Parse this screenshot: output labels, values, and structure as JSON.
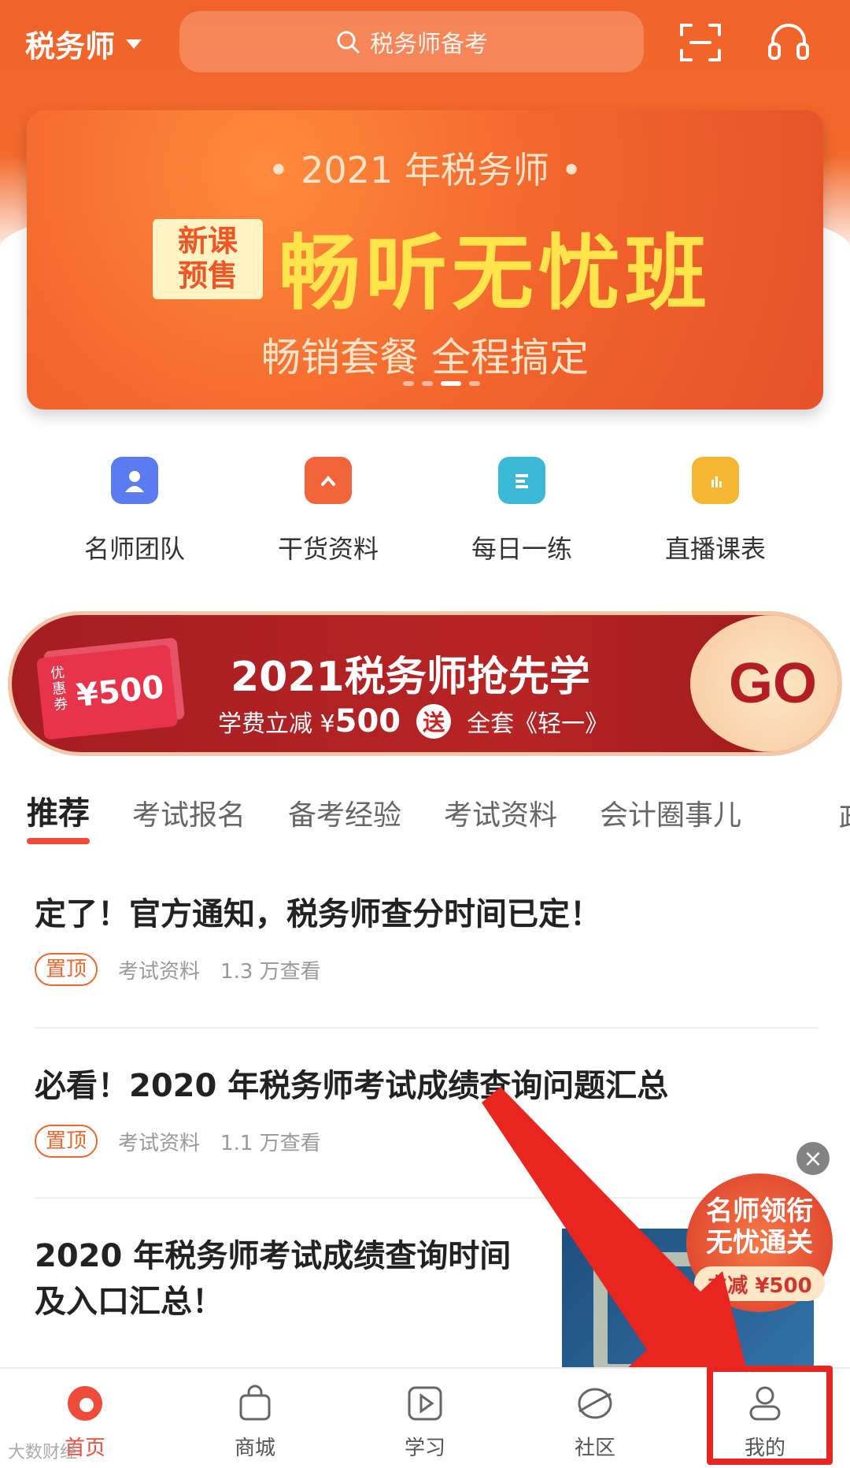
{
  "header": {
    "city": "税务师",
    "search_placeholder": "税务师备考"
  },
  "banner": {
    "subtitle": "• 2021 年税务师 •",
    "badge_line1": "新课",
    "badge_line2": "预售",
    "main": "畅听无忧班",
    "tagline": "畅销套餐 全程搞定"
  },
  "quick_entries": [
    {
      "label": "名师团队",
      "icon": "teacher-icon",
      "color": "#5b7cf0"
    },
    {
      "label": "干货资料",
      "icon": "folder-icon",
      "color": "#f2653a"
    },
    {
      "label": "每日一练",
      "icon": "calendar-icon",
      "color": "#3bb8d6"
    },
    {
      "label": "直播课表",
      "icon": "tv-icon",
      "color": "#f5b731"
    }
  ],
  "promo": {
    "coupon_tag": "优惠券",
    "coupon_value": "¥500",
    "title": "2021税务师抢先学",
    "sub_prefix": "学费立减 ¥",
    "sub_amount": "500",
    "send": "送",
    "sub_suffix": "全套《轻一》",
    "go": "GO"
  },
  "tabs": [
    "推荐",
    "考试报名",
    "备考经验",
    "考试资料",
    "会计圈事儿",
    "政"
  ],
  "articles": [
    {
      "title": "定了！官方通知，税务师查分时间已定！",
      "tag": "置顶",
      "category": "考试资料",
      "views": "1.3 万查看"
    },
    {
      "title": "必看！2020 年税务师考试成绩查询问题汇总",
      "tag": "置顶",
      "category": "考试资料",
      "views": "1.1 万查看"
    },
    {
      "title_line1": "2020 年税务师考试成绩查询时间",
      "title_line2": "及入口汇总！"
    }
  ],
  "float_ad": {
    "line1": "名师领衔",
    "line2": "无忧通关",
    "offer": "立减 ¥500"
  },
  "bottom_nav": [
    {
      "label": "首页",
      "icon": "home-icon",
      "active": true
    },
    {
      "label": "商城",
      "icon": "shop-bag-icon",
      "active": false
    },
    {
      "label": "学习",
      "icon": "play-icon",
      "active": false
    },
    {
      "label": "社区",
      "icon": "community-icon",
      "active": false
    },
    {
      "label": "我的",
      "icon": "profile-icon",
      "active": false
    }
  ],
  "colors": {
    "brand": "#f0622a",
    "accent_red": "#ee4b3a",
    "highlight_box": "#e8261f"
  },
  "watermark": "大数财经"
}
